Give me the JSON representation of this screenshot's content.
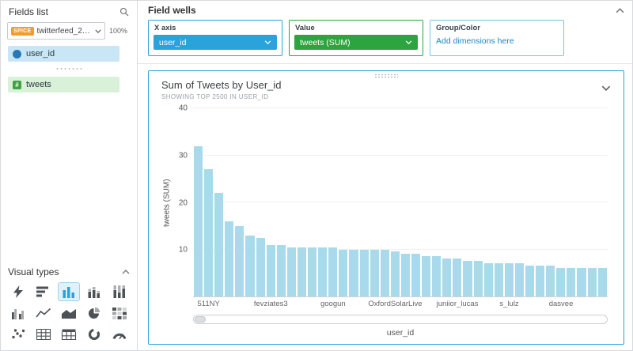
{
  "sidebar": {
    "title": "Fields list",
    "dataset": {
      "badge": "SPICE",
      "name": "twitterfeed_2017-...",
      "capacity": "100%"
    },
    "fields": [
      {
        "label": "user_id",
        "type": "dimension"
      },
      {
        "label": "tweets",
        "type": "measure",
        "icon_glyph": "#"
      }
    ],
    "visual_types": {
      "title": "Visual types",
      "selected": "vertical-bar",
      "items": [
        "auto-graph",
        "horizontal-bar",
        "vertical-bar",
        "stacked-bar",
        "stacked-100-bar",
        "grouped-bar",
        "line-chart",
        "area-chart",
        "pie-chart",
        "heat-map",
        "scatter-plot",
        "table",
        "pivot-table",
        "donut-chart",
        "gauge"
      ]
    }
  },
  "field_wells": {
    "title": "Field wells",
    "x_axis": {
      "label": "X axis",
      "value": "user_id"
    },
    "value": {
      "label": "Value",
      "value": "tweets (SUM)"
    },
    "group_color": {
      "label": "Group/Color",
      "placeholder": "Add dimensions here"
    }
  },
  "chart": {
    "title": "Sum of Tweets by User_id",
    "subtitle": "SHOWING TOP 2500 IN USER_ID"
  },
  "chart_data": {
    "type": "bar",
    "title": "Sum of Tweets by User_id",
    "xlabel": "user_id",
    "ylabel": "tweets (SUM)",
    "ylim": [
      0,
      40
    ],
    "yticks": [
      10,
      20,
      30,
      40
    ],
    "bar_color": "#A8DAEC",
    "values": [
      32,
      27,
      22,
      16,
      15,
      13,
      12.5,
      11,
      11,
      10.5,
      10.5,
      10.5,
      10.5,
      10.5,
      10,
      10,
      10,
      10,
      10,
      9.5,
      9,
      9,
      8.5,
      8.5,
      8,
      8,
      7.5,
      7.5,
      7,
      7,
      7,
      7,
      6.5,
      6.5,
      6.5,
      6,
      6,
      6,
      6,
      6
    ],
    "x_tick_labels": [
      {
        "index": 1,
        "label": "511NY"
      },
      {
        "index": 7,
        "label": "fevziates3"
      },
      {
        "index": 13,
        "label": "googun"
      },
      {
        "index": 19,
        "label": "OxfordSolarLive"
      },
      {
        "index": 25,
        "label": "juniior_lucas"
      },
      {
        "index": 30,
        "label": "s_lulz"
      },
      {
        "index": 35,
        "label": "dasvee"
      }
    ]
  },
  "colors": {
    "accent_blue": "#29A3D9",
    "accent_green": "#2EA43F",
    "bar_fill": "#A8DAEC",
    "spice_orange": "#F39C2C",
    "link_blue": "#1887C4",
    "field_dim_bg": "#C8E6F5",
    "field_measure_bg": "#D9F0D9"
  }
}
